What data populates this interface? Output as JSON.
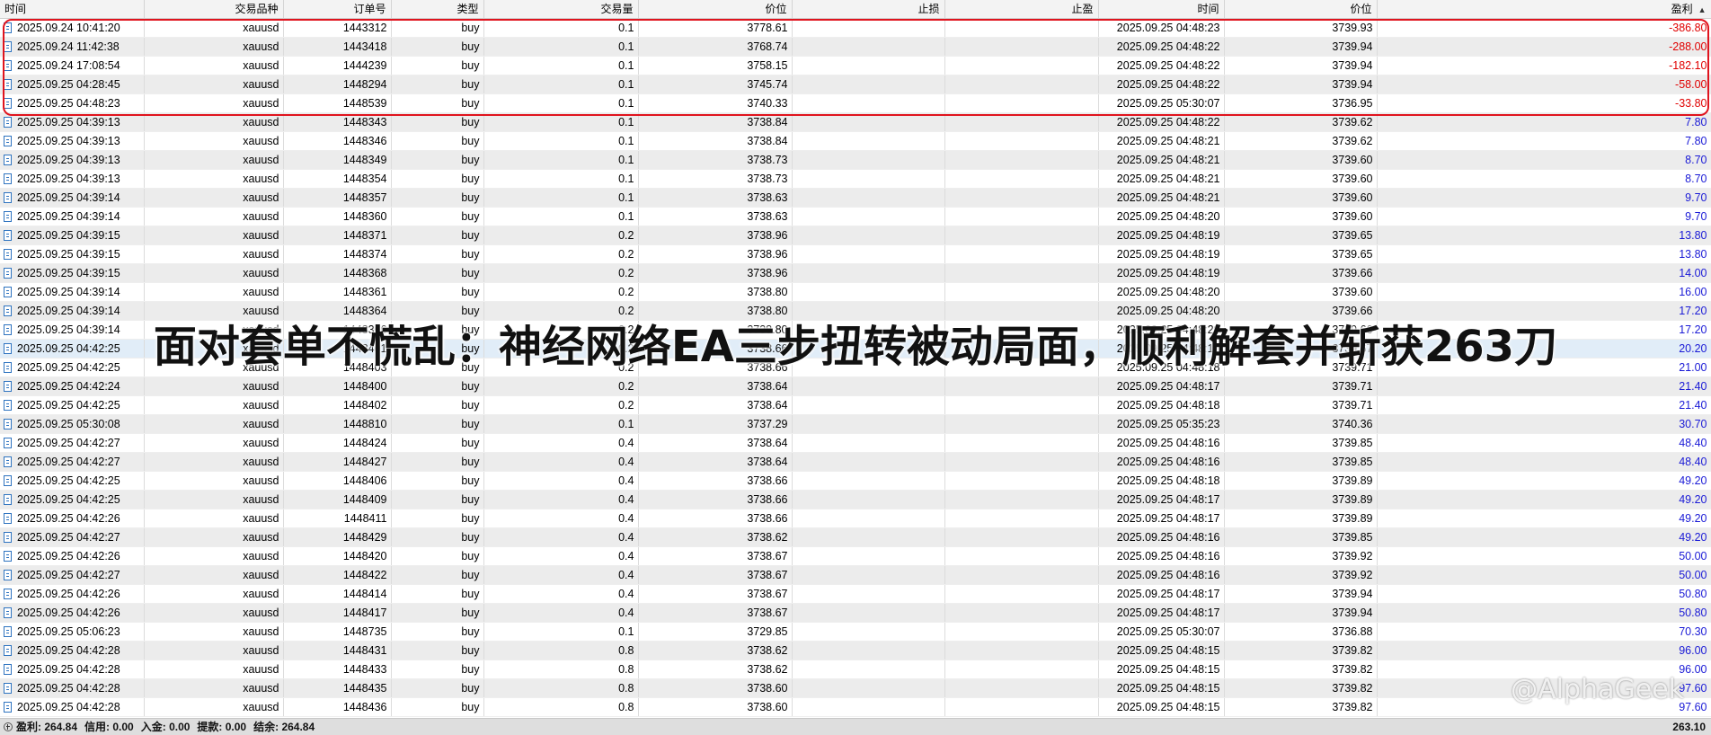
{
  "columns": [
    {
      "key": "open_time",
      "label": "时间"
    },
    {
      "key": "symbol",
      "label": "交易品种"
    },
    {
      "key": "order",
      "label": "订单号"
    },
    {
      "key": "type",
      "label": "类型"
    },
    {
      "key": "volume",
      "label": "交易量"
    },
    {
      "key": "open_price",
      "label": "价位"
    },
    {
      "key": "sl",
      "label": "止损"
    },
    {
      "key": "tp",
      "label": "止盈"
    },
    {
      "key": "close_time",
      "label": "时间"
    },
    {
      "key": "close_price",
      "label": "价位"
    },
    {
      "key": "profit",
      "label": "盈利"
    }
  ],
  "sort_icon": "sort-ascending-icon",
  "row_icon": "document-icon",
  "rows": [
    [
      "2025.09.24 10:41:20",
      "xauusd",
      "1443312",
      "buy",
      "0.1",
      "3778.61",
      "",
      "",
      "2025.09.25 04:48:23",
      "3739.93",
      "-386.80"
    ],
    [
      "2025.09.24 11:42:38",
      "xauusd",
      "1443418",
      "buy",
      "0.1",
      "3768.74",
      "",
      "",
      "2025.09.25 04:48:22",
      "3739.94",
      "-288.00"
    ],
    [
      "2025.09.24 17:08:54",
      "xauusd",
      "1444239",
      "buy",
      "0.1",
      "3758.15",
      "",
      "",
      "2025.09.25 04:48:22",
      "3739.94",
      "-182.10"
    ],
    [
      "2025.09.25 04:28:45",
      "xauusd",
      "1448294",
      "buy",
      "0.1",
      "3745.74",
      "",
      "",
      "2025.09.25 04:48:22",
      "3739.94",
      "-58.00"
    ],
    [
      "2025.09.25 04:48:23",
      "xauusd",
      "1448539",
      "buy",
      "0.1",
      "3740.33",
      "",
      "",
      "2025.09.25 05:30:07",
      "3736.95",
      "-33.80"
    ],
    [
      "2025.09.25 04:39:13",
      "xauusd",
      "1448343",
      "buy",
      "0.1",
      "3738.84",
      "",
      "",
      "2025.09.25 04:48:22",
      "3739.62",
      "7.80"
    ],
    [
      "2025.09.25 04:39:13",
      "xauusd",
      "1448346",
      "buy",
      "0.1",
      "3738.84",
      "",
      "",
      "2025.09.25 04:48:21",
      "3739.62",
      "7.80"
    ],
    [
      "2025.09.25 04:39:13",
      "xauusd",
      "1448349",
      "buy",
      "0.1",
      "3738.73",
      "",
      "",
      "2025.09.25 04:48:21",
      "3739.60",
      "8.70"
    ],
    [
      "2025.09.25 04:39:13",
      "xauusd",
      "1448354",
      "buy",
      "0.1",
      "3738.73",
      "",
      "",
      "2025.09.25 04:48:21",
      "3739.60",
      "8.70"
    ],
    [
      "2025.09.25 04:39:14",
      "xauusd",
      "1448357",
      "buy",
      "0.1",
      "3738.63",
      "",
      "",
      "2025.09.25 04:48:21",
      "3739.60",
      "9.70"
    ],
    [
      "2025.09.25 04:39:14",
      "xauusd",
      "1448360",
      "buy",
      "0.1",
      "3738.63",
      "",
      "",
      "2025.09.25 04:48:20",
      "3739.60",
      "9.70"
    ],
    [
      "2025.09.25 04:39:15",
      "xauusd",
      "1448371",
      "buy",
      "0.2",
      "3738.96",
      "",
      "",
      "2025.09.25 04:48:19",
      "3739.65",
      "13.80"
    ],
    [
      "2025.09.25 04:39:15",
      "xauusd",
      "1448374",
      "buy",
      "0.2",
      "3738.96",
      "",
      "",
      "2025.09.25 04:48:19",
      "3739.65",
      "13.80"
    ],
    [
      "2025.09.25 04:39:15",
      "xauusd",
      "1448368",
      "buy",
      "0.2",
      "3738.96",
      "",
      "",
      "2025.09.25 04:48:19",
      "3739.66",
      "14.00"
    ],
    [
      "2025.09.25 04:39:14",
      "xauusd",
      "1448361",
      "buy",
      "0.2",
      "3738.80",
      "",
      "",
      "2025.09.25 04:48:20",
      "3739.60",
      "16.00"
    ],
    [
      "2025.09.25 04:39:14",
      "xauusd",
      "1448364",
      "buy",
      "0.2",
      "3738.80",
      "",
      "",
      "2025.09.25 04:48:20",
      "3739.66",
      "17.20"
    ],
    [
      "2025.09.25 04:39:14",
      "xauusd",
      "1448366",
      "buy",
      "0.2",
      "3738.80",
      "",
      "",
      "2025.09.25 04:48:20",
      "3739.66",
      "17.20"
    ],
    [
      "2025.09.25 04:42:25",
      "xauusd",
      "1448401",
      "buy",
      "0.2",
      "3738.66",
      "",
      "",
      "2025.09.25 04:48:19",
      "3739.67",
      "20.20"
    ],
    [
      "2025.09.25 04:42:25",
      "xauusd",
      "1448403",
      "buy",
      "0.2",
      "3738.66",
      "",
      "",
      "2025.09.25 04:48:18",
      "3739.71",
      "21.00"
    ],
    [
      "2025.09.25 04:42:24",
      "xauusd",
      "1448400",
      "buy",
      "0.2",
      "3738.64",
      "",
      "",
      "2025.09.25 04:48:17",
      "3739.71",
      "21.40"
    ],
    [
      "2025.09.25 04:42:25",
      "xauusd",
      "1448402",
      "buy",
      "0.2",
      "3738.64",
      "",
      "",
      "2025.09.25 04:48:18",
      "3739.71",
      "21.40"
    ],
    [
      "2025.09.25 05:30:08",
      "xauusd",
      "1448810",
      "buy",
      "0.1",
      "3737.29",
      "",
      "",
      "2025.09.25 05:35:23",
      "3740.36",
      "30.70"
    ],
    [
      "2025.09.25 04:42:27",
      "xauusd",
      "1448424",
      "buy",
      "0.4",
      "3738.64",
      "",
      "",
      "2025.09.25 04:48:16",
      "3739.85",
      "48.40"
    ],
    [
      "2025.09.25 04:42:27",
      "xauusd",
      "1448427",
      "buy",
      "0.4",
      "3738.64",
      "",
      "",
      "2025.09.25 04:48:16",
      "3739.85",
      "48.40"
    ],
    [
      "2025.09.25 04:42:25",
      "xauusd",
      "1448406",
      "buy",
      "0.4",
      "3738.66",
      "",
      "",
      "2025.09.25 04:48:18",
      "3739.89",
      "49.20"
    ],
    [
      "2025.09.25 04:42:25",
      "xauusd",
      "1448409",
      "buy",
      "0.4",
      "3738.66",
      "",
      "",
      "2025.09.25 04:48:17",
      "3739.89",
      "49.20"
    ],
    [
      "2025.09.25 04:42:26",
      "xauusd",
      "1448411",
      "buy",
      "0.4",
      "3738.66",
      "",
      "",
      "2025.09.25 04:48:17",
      "3739.89",
      "49.20"
    ],
    [
      "2025.09.25 04:42:27",
      "xauusd",
      "1448429",
      "buy",
      "0.4",
      "3738.62",
      "",
      "",
      "2025.09.25 04:48:16",
      "3739.85",
      "49.20"
    ],
    [
      "2025.09.25 04:42:26",
      "xauusd",
      "1448420",
      "buy",
      "0.4",
      "3738.67",
      "",
      "",
      "2025.09.25 04:48:16",
      "3739.92",
      "50.00"
    ],
    [
      "2025.09.25 04:42:27",
      "xauusd",
      "1448422",
      "buy",
      "0.4",
      "3738.67",
      "",
      "",
      "2025.09.25 04:48:16",
      "3739.92",
      "50.00"
    ],
    [
      "2025.09.25 04:42:26",
      "xauusd",
      "1448414",
      "buy",
      "0.4",
      "3738.67",
      "",
      "",
      "2025.09.25 04:48:17",
      "3739.94",
      "50.80"
    ],
    [
      "2025.09.25 04:42:26",
      "xauusd",
      "1448417",
      "buy",
      "0.4",
      "3738.67",
      "",
      "",
      "2025.09.25 04:48:17",
      "3739.94",
      "50.80"
    ],
    [
      "2025.09.25 05:06:23",
      "xauusd",
      "1448735",
      "buy",
      "0.1",
      "3729.85",
      "",
      "",
      "2025.09.25 05:30:07",
      "3736.88",
      "70.30"
    ],
    [
      "2025.09.25 04:42:28",
      "xauusd",
      "1448431",
      "buy",
      "0.8",
      "3738.62",
      "",
      "",
      "2025.09.25 04:48:15",
      "3739.82",
      "96.00"
    ],
    [
      "2025.09.25 04:42:28",
      "xauusd",
      "1448433",
      "buy",
      "0.8",
      "3738.62",
      "",
      "",
      "2025.09.25 04:48:15",
      "3739.82",
      "96.00"
    ],
    [
      "2025.09.25 04:42:28",
      "xauusd",
      "1448435",
      "buy",
      "0.8",
      "3738.60",
      "",
      "",
      "2025.09.25 04:48:15",
      "3739.82",
      "97.60"
    ],
    [
      "2025.09.25 04:42:28",
      "xauusd",
      "1448436",
      "buy",
      "0.8",
      "3738.60",
      "",
      "",
      "2025.09.25 04:48:15",
      "3739.82",
      "97.60"
    ]
  ],
  "selected_row_index": 17,
  "highlighted_row_count": 5,
  "overlay_title": "面对套单不慌乱：神经网络EA三步扭转被动局面，顺利解套并斩获263刀",
  "watermark": "@AlphaGeek",
  "footer": {
    "icon": "plus-circle-icon",
    "items": [
      "盈利: 264.84",
      "信用: 0.00",
      "入金: 0.00",
      "提款: 0.00",
      "结余: 264.84"
    ],
    "total": "263.10"
  },
  "colors": {
    "loss": "#e00000",
    "profit": "#1a1ad6",
    "highlight_box": "#e0141e",
    "selected_row": "#e1edf8"
  }
}
